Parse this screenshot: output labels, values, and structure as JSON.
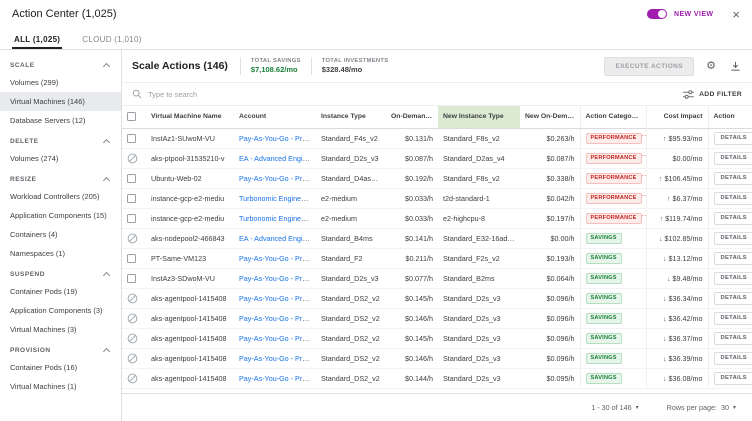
{
  "icons": {
    "gear": "⚙",
    "close": "×",
    "caret_down": "▾",
    "sort_ascending": "↑",
    "arrow_up": "↑",
    "arrow_down": "↓"
  },
  "header": {
    "title": "Action Center (1,025)",
    "new_view_label": "NEW VIEW"
  },
  "tabs": [
    {
      "label": "ALL (1,025)",
      "active": true
    },
    {
      "label": "CLOUD (1,010)",
      "active": false
    }
  ],
  "sidebar": {
    "groups": [
      {
        "label": "SCALE",
        "items": [
          {
            "label": "Volumes (299)",
            "selected": false
          },
          {
            "label": "Virtual Machines (146)",
            "selected": true
          },
          {
            "label": "Database Servers (12)",
            "selected": false
          }
        ]
      },
      {
        "label": "DELETE",
        "items": [
          {
            "label": "Volumes (274)",
            "selected": false
          }
        ]
      },
      {
        "label": "RESIZE",
        "items": [
          {
            "label": "Workload Controllers (205)",
            "selected": false
          },
          {
            "label": "Application Components (15)",
            "selected": false
          },
          {
            "label": "Containers (4)",
            "selected": false
          },
          {
            "label": "Namespaces (1)",
            "selected": false
          }
        ]
      },
      {
        "label": "SUSPEND",
        "items": [
          {
            "label": "Container Pods (19)",
            "selected": false
          },
          {
            "label": "Application Components (3)",
            "selected": false
          },
          {
            "label": "Virtual Machines (3)",
            "selected": false
          }
        ]
      },
      {
        "label": "PROVISION",
        "items": [
          {
            "label": "Container Pods (16)",
            "selected": false
          },
          {
            "label": "Virtual Machines (1)",
            "selected": false
          }
        ]
      }
    ]
  },
  "main": {
    "title": "Scale Actions (146)",
    "stats": [
      {
        "label": "TOTAL SAVINGS",
        "value": "$7,108.62/mo",
        "color": "#188038"
      },
      {
        "label": "TOTAL INVESTMENTS",
        "value": "$328.48/mo",
        "color": "#3c4043"
      }
    ],
    "toolbar": {
      "execute_label": "EXECUTE ACTIONS"
    },
    "search": {
      "placeholder": "Type to search",
      "add_filter_label": "ADD FILTER"
    },
    "table": {
      "details_label": "DETAILS",
      "columns": [
        {
          "label": "Virtual Machine Name"
        },
        {
          "label": "Account"
        },
        {
          "label": "Instance Type"
        },
        {
          "label": "On-Demand Cost",
          "align": "right"
        },
        {
          "label": "New Instance Type",
          "highlight": true
        },
        {
          "label": "New On-Demand Cost",
          "align": "right"
        },
        {
          "label": "Action Category",
          "sorted": true
        },
        {
          "label": "Cost Impact",
          "align": "right"
        },
        {
          "label": "Action"
        }
      ],
      "rows": [
        {
          "selectable": true,
          "name": "InstAz1-SUwoM-VU",
          "account": "Pay-As-You-Go - Produ",
          "instance_type": "Standard_F4s_v2",
          "on_demand_cost": "$0.131/h",
          "new_instance_type": "Standard_F8s_v2",
          "new_on_demand_cost": "$0.263/h",
          "category": "PERFORMANCE",
          "impact_dir": "up",
          "impact": "$95.93/mo"
        },
        {
          "selectable": false,
          "name": "aks-ptpool-31535210-v",
          "account": "EA - Advanced Enginee",
          "instance_type": "Standard_D2s_v3",
          "on_demand_cost": "$0.087/h",
          "new_instance_type": "Standard_D2as_v4",
          "new_on_demand_cost": "$0.087/h",
          "category": "PERFORMANCE",
          "impact_dir": "none",
          "impact": "$0.00/mo"
        },
        {
          "selectable": true,
          "name": "Ubuntu-Web-02",
          "account": "Pay-As-You-Go - Produ",
          "instance_type": "Standard_D4as_v4",
          "on_demand_cost": "$0.192/h",
          "new_instance_type": "Standard_F8s_v2",
          "new_on_demand_cost": "$0.338/h",
          "category": "PERFORMANCE",
          "impact_dir": "up",
          "impact": "$106.45/mo"
        },
        {
          "selectable": true,
          "name": "instance-gcp-e2-mediu",
          "account": "Turbonomic Engineering",
          "instance_type": "e2-medium",
          "on_demand_cost": "$0.033/h",
          "new_instance_type": "t2d-standard-1",
          "new_on_demand_cost": "$0.042/h",
          "category": "PERFORMANCE",
          "impact_dir": "up",
          "impact": "$6.37/mo"
        },
        {
          "selectable": true,
          "name": "instance-gcp-e2-mediu",
          "account": "Turbonomic Engineering",
          "instance_type": "e2-medium",
          "on_demand_cost": "$0.033/h",
          "new_instance_type": "e2-highcpu-8",
          "new_on_demand_cost": "$0.197/h",
          "category": "PERFORMANCE",
          "impact_dir": "up",
          "impact": "$119.74/mo"
        },
        {
          "selectable": false,
          "name": "aks-nodepool2-466843",
          "account": "EA - Advanced Enginee",
          "instance_type": "Standard_B4ms",
          "on_demand_cost": "$0.141/h",
          "new_instance_type": "Standard_E32-16ads...",
          "new_on_demand_cost": "$0.00/h",
          "category": "SAVINGS",
          "impact_dir": "down",
          "impact": "$102.85/mo"
        },
        {
          "selectable": true,
          "name": "PT-Same-VM123",
          "account": "Pay-As-You-Go - Produ",
          "instance_type": "Standard_F2",
          "on_demand_cost": "$0.211/h",
          "new_instance_type": "Standard_F2s_v2",
          "new_on_demand_cost": "$0.193/h",
          "category": "SAVINGS",
          "impact_dir": "down",
          "impact": "$13.12/mo"
        },
        {
          "selectable": true,
          "name": "InstAz3-SDwoM-VU",
          "account": "Pay-As-You-Go - Produ",
          "instance_type": "Standard_D2s_v3",
          "on_demand_cost": "$0.077/h",
          "new_instance_type": "Standard_B2ms",
          "new_on_demand_cost": "$0.064/h",
          "category": "SAVINGS",
          "impact_dir": "down",
          "impact": "$9.48/mo"
        },
        {
          "selectable": false,
          "name": "aks-agentpool-1415408",
          "account": "Pay-As-You-Go - Produ",
          "instance_type": "Standard_DS2_v2",
          "on_demand_cost": "$0.145/h",
          "new_instance_type": "Standard_D2s_v3",
          "new_on_demand_cost": "$0.096/h",
          "category": "SAVINGS",
          "impact_dir": "down",
          "impact": "$36.34/mo"
        },
        {
          "selectable": false,
          "name": "aks-agentpool-1415408",
          "account": "Pay-As-You-Go - Produ",
          "instance_type": "Standard_DS2_v2",
          "on_demand_cost": "$0.146/h",
          "new_instance_type": "Standard_D2s_v3",
          "new_on_demand_cost": "$0.096/h",
          "category": "SAVINGS",
          "impact_dir": "down",
          "impact": "$36.42/mo"
        },
        {
          "selectable": false,
          "name": "aks-agentpool-1415408",
          "account": "Pay-As-You-Go - Produ",
          "instance_type": "Standard_DS2_v2",
          "on_demand_cost": "$0.145/h",
          "new_instance_type": "Standard_D2s_v3",
          "new_on_demand_cost": "$0.096/h",
          "category": "SAVINGS",
          "impact_dir": "down",
          "impact": "$36.37/mo"
        },
        {
          "selectable": false,
          "name": "aks-agentpool-1415408",
          "account": "Pay-As-You-Go - Produ",
          "instance_type": "Standard_DS2_v2",
          "on_demand_cost": "$0.146/h",
          "new_instance_type": "Standard_D2s_v3",
          "new_on_demand_cost": "$0.096/h",
          "category": "SAVINGS",
          "impact_dir": "down",
          "impact": "$36.39/mo"
        },
        {
          "selectable": false,
          "name": "aks-agentpool-1415408",
          "account": "Pay-As-You-Go - Produ",
          "instance_type": "Standard_DS2_v2",
          "on_demand_cost": "$0.144/h",
          "new_instance_type": "Standard_D2s_v3",
          "new_on_demand_cost": "$0.095/h",
          "category": "SAVINGS",
          "impact_dir": "down",
          "impact": "$36.08/mo"
        }
      ]
    },
    "pagination": {
      "range": "1 - 30 of 146",
      "rows_per_page_label": "Rows per page:",
      "rows_per_page_value": "30"
    }
  },
  "colors": {
    "accent_purple": "#a21caf",
    "savings_green": "#188038",
    "performance_red": "#c5221f",
    "link_blue": "#1a73e8",
    "new_column_highlight": "#dcead2",
    "selected_sidebar": "#e8eaed"
  }
}
